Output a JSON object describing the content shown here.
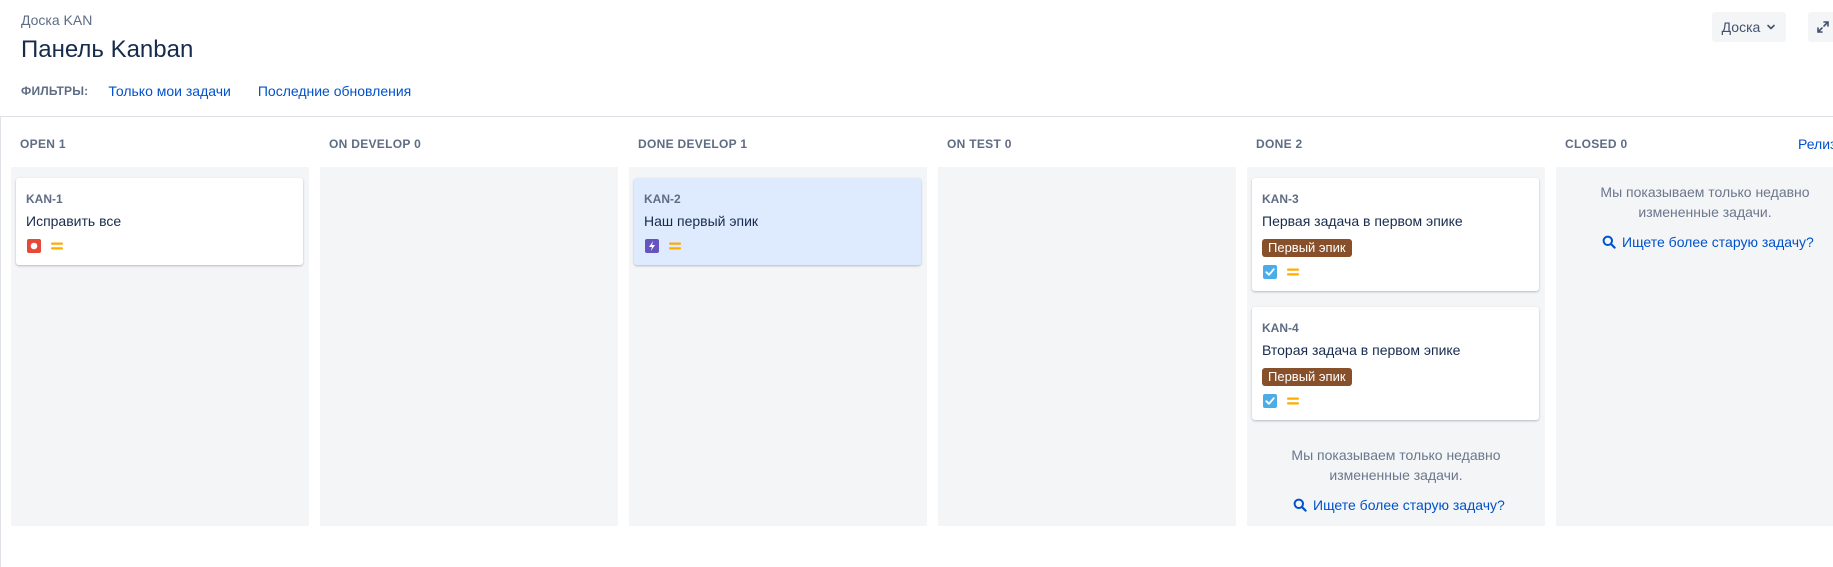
{
  "header": {
    "breadcrumb": "Доска KAN",
    "title": "Панель Kanban",
    "board_button_label": "Доска"
  },
  "filters": {
    "label": "ФИЛЬТРЫ:",
    "items": [
      "Только мои задачи",
      "Последние обновления"
    ]
  },
  "columns": [
    {
      "name": "OPEN",
      "count": "1"
    },
    {
      "name": "ON DEVELOP",
      "count": "0"
    },
    {
      "name": "DONE DEVELOP",
      "count": "1"
    },
    {
      "name": "ON TEST",
      "count": "0"
    },
    {
      "name": "DONE",
      "count": "2"
    },
    {
      "name": "CLOSED",
      "count": "0"
    }
  ],
  "release_link": "Релиз",
  "cards": [
    {
      "key": "KAN-1",
      "summary": "Исправить все",
      "type_icon": "bug-icon",
      "priority_icon": "priority-medium-icon"
    },
    {
      "key": "KAN-2",
      "summary": "Наш первый эпик",
      "type_icon": "epic-icon",
      "priority_icon": "priority-medium-icon"
    },
    {
      "key": "KAN-3",
      "summary": "Первая задача в первом эпике",
      "epic": "Первый эпик",
      "type_icon": "task-icon",
      "priority_icon": "priority-medium-icon"
    },
    {
      "key": "KAN-4",
      "summary": "Вторая задача в первом эпике",
      "epic": "Первый эпик",
      "type_icon": "task-icon",
      "priority_icon": "priority-medium-icon"
    }
  ],
  "notices": {
    "recent_line1": "Мы показываем только недавно",
    "recent_line2": "измененные задачи.",
    "older_link": "Ищете более старую задачу?"
  },
  "colors": {
    "accent": "#0052cc",
    "epic_label": "#87502b",
    "bug": "#e5493a",
    "epic": "#6554c0",
    "task": "#4bade8",
    "priority_medium": "#ffab00",
    "selected_card": "#deebff"
  }
}
